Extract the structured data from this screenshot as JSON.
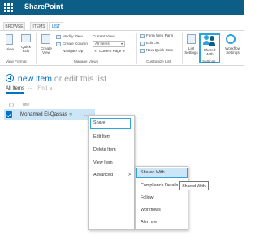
{
  "app": {
    "title": "SharePoint"
  },
  "ribbon_tabs": [
    "BROWSE",
    "ITEMS",
    "LIST"
  ],
  "ribbon": {
    "view_format": {
      "view": "View",
      "quick_edit": "Quick Edit",
      "label": "View Format"
    },
    "manage_views": {
      "create_view": "Create View",
      "modify_view": "Modify View",
      "create_column": "Create Column",
      "navigate_up": "Navigate Up",
      "current_view_label": "Current View:",
      "current_view_value": "All Items",
      "current_page": "Current Page",
      "label": "Manage Views"
    },
    "customize_list": {
      "form_web_parts": "Form Web Parts",
      "edit_list": "Edit List",
      "new_quick_step": "New Quick Step",
      "label": "Customize List"
    },
    "settings": {
      "list_settings": "List Settings",
      "shared_with": "Shared With",
      "workflow_settings": "Workflow Settings",
      "label": "Settings"
    }
  },
  "main": {
    "new_item": "new item",
    "or_edit": "or edit this list",
    "views_all_items": "All Items",
    "find_item": "Find",
    "column_title": "Title",
    "row_name": "Mohamed El-Qassas",
    "ellipsis": "..."
  },
  "menu": {
    "items": [
      "Share",
      "Edit Item",
      "Delete Item",
      "View Item",
      "Advanced"
    ],
    "advanced_arrow": ">"
  },
  "submenu": {
    "items": [
      "Shared With",
      "Compliance Details",
      "Follow",
      "Workflows",
      "Alert me"
    ]
  },
  "tooltip": "Shared With",
  "colors": {
    "suite_bar": "#0d5e86",
    "accent": "#0072c6",
    "highlight": "#2ea3dc",
    "selection": "#cde6f7"
  }
}
